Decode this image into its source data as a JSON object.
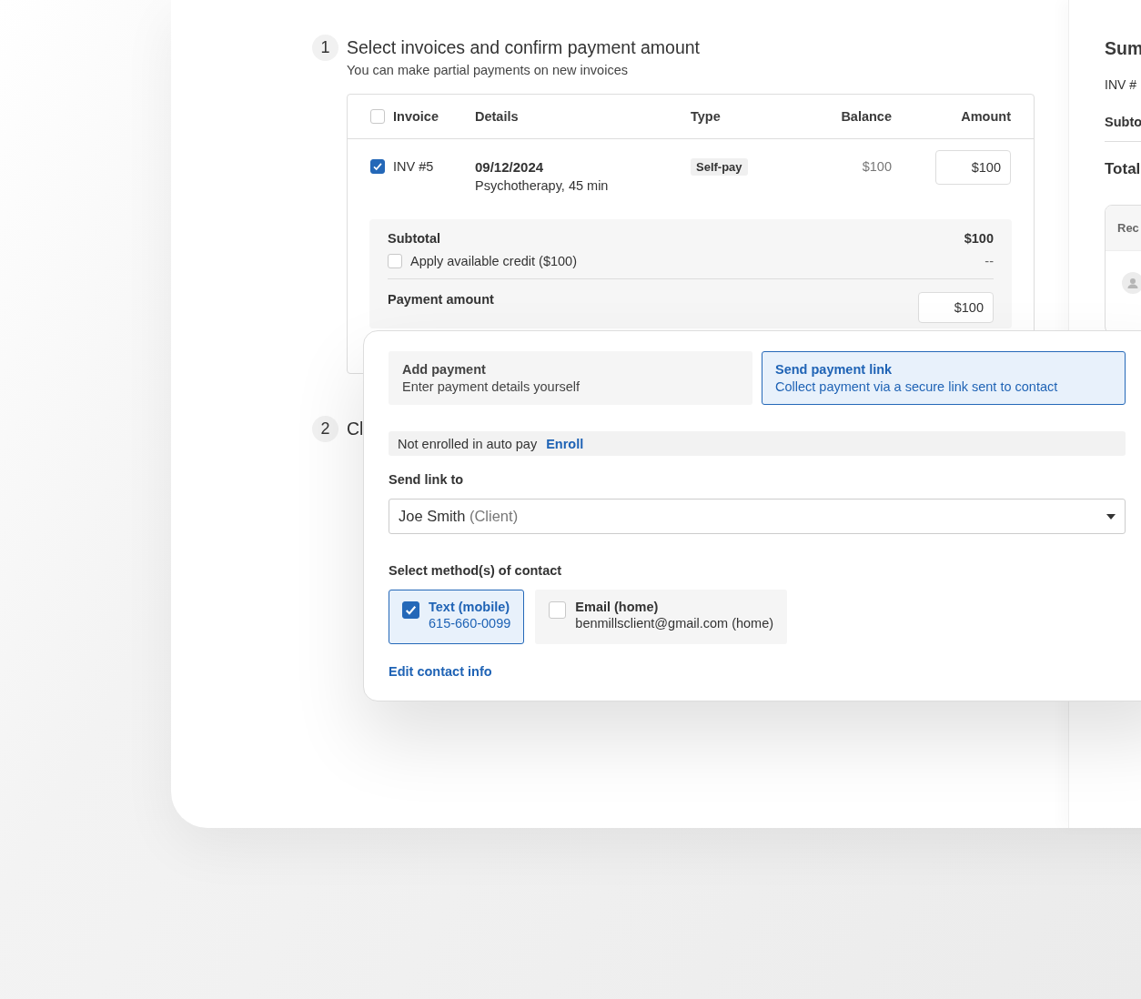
{
  "steps": [
    {
      "number": "1",
      "title": "Select invoices and confirm payment amount",
      "subtitle": "You can make partial payments on new invoices"
    },
    {
      "number": "2",
      "title": "Cl"
    }
  ],
  "invoice_table": {
    "columns": [
      "Invoice",
      "Details",
      "Type",
      "Balance",
      "Amount"
    ],
    "select_all_checked": false,
    "rows": [
      {
        "checked": true,
        "invoice": "INV #5",
        "date": "09/12/2024",
        "service": "Psychotherapy, 45 min",
        "type": "Self-pay",
        "balance": "$100",
        "amount": "$100"
      }
    ]
  },
  "totals": {
    "subtotal_label": "Subtotal",
    "subtotal": "$100",
    "credit_label": "Apply available credit ($100)",
    "credit_checked": false,
    "credit_value": "--",
    "payment_label": "Payment amount",
    "payment_value": "$100"
  },
  "summary": {
    "title": "Sum",
    "line": "INV #",
    "subtotal": "Subto",
    "total": "Total",
    "recipient_header": "Rec"
  },
  "payment_panel": {
    "options": [
      {
        "title": "Add payment",
        "description": "Enter payment details yourself",
        "selected": false
      },
      {
        "title": "Send payment link",
        "description": "Collect payment via a secure link sent to contact",
        "selected": true
      }
    ],
    "autopay": {
      "text": "Not enrolled in auto pay",
      "link": "Enroll"
    },
    "send_to_label": "Send link to",
    "recipient": {
      "name": "Joe Smith",
      "role": "(Client)"
    },
    "methods_label": "Select method(s) of contact",
    "methods": [
      {
        "title": "Text (mobile)",
        "detail": "615-660-0099",
        "checked": true
      },
      {
        "title": "Email (home)",
        "detail": "benmillsclient@gmail.com (home)",
        "checked": false
      }
    ],
    "edit_link": "Edit contact info"
  }
}
